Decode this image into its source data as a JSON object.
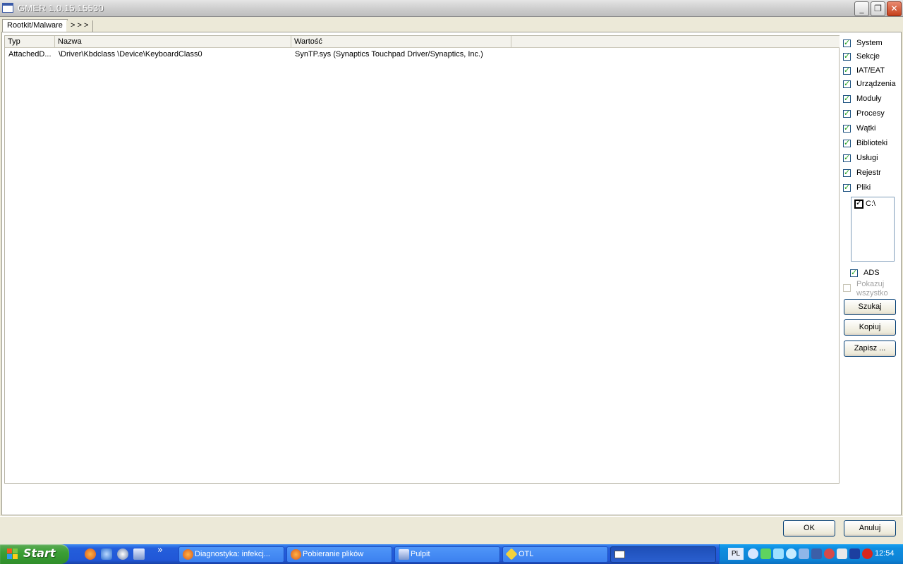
{
  "window": {
    "title": "GMER 1.0.15.15530",
    "minimize_glyph": "_",
    "restore_glyph": "❐",
    "close_glyph": "✕"
  },
  "tabs": [
    {
      "label": "Rootkit/Malware"
    },
    {
      "label": "> > >"
    }
  ],
  "list": {
    "columns": [
      "Typ",
      "Nazwa",
      "Wartość"
    ],
    "rows": [
      {
        "type": "AttachedD...",
        "name": "\\Driver\\Kbdclass \\Device\\KeyboardClass0",
        "value": "SynTP.sys (Synaptics Touchpad Driver/Synaptics, Inc.)"
      }
    ]
  },
  "options": [
    {
      "label": "System",
      "checked": true
    },
    {
      "label": "Sekcje",
      "checked": true
    },
    {
      "label": "IAT/EAT",
      "checked": true
    },
    {
      "label": "Urządzenia",
      "checked": true
    },
    {
      "label": "Moduły",
      "checked": true
    },
    {
      "label": "Procesy",
      "checked": true
    },
    {
      "label": "Wątki",
      "checked": true
    },
    {
      "label": "Biblioteki",
      "checked": true
    },
    {
      "label": "Usługi",
      "checked": true
    },
    {
      "label": "Rejestr",
      "checked": true
    },
    {
      "label": "Pliki",
      "checked": true
    }
  ],
  "drives": [
    {
      "label": "C:\\",
      "checked": true
    }
  ],
  "ads": {
    "label": "ADS",
    "checked": true
  },
  "show_all": {
    "label_line1": "Pokazuj",
    "label_line2": "wszystko",
    "checked": false,
    "disabled": true
  },
  "buttons": {
    "search": "Szukaj",
    "copy": "Kopiuj",
    "save": "Zapisz ...",
    "ok": "OK",
    "cancel": "Anuluj"
  },
  "taskbar": {
    "start_label": "Start",
    "overflow": "»",
    "items": [
      {
        "label": "Diagnostyka: infekcj...",
        "icon": "firefox-icon"
      },
      {
        "label": "Pobieranie plików",
        "icon": "firefox-icon"
      },
      {
        "label": "Pulpit",
        "icon": "folder-icon"
      },
      {
        "label": "OTL",
        "icon": "otl-icon"
      },
      {
        "label": "",
        "icon": "gmer-icon"
      }
    ],
    "language": "PL",
    "clock": "12:54"
  },
  "colors": {
    "taskbar": "#245edb",
    "start": "#3c9f35",
    "tray": "#0f8ee0"
  }
}
